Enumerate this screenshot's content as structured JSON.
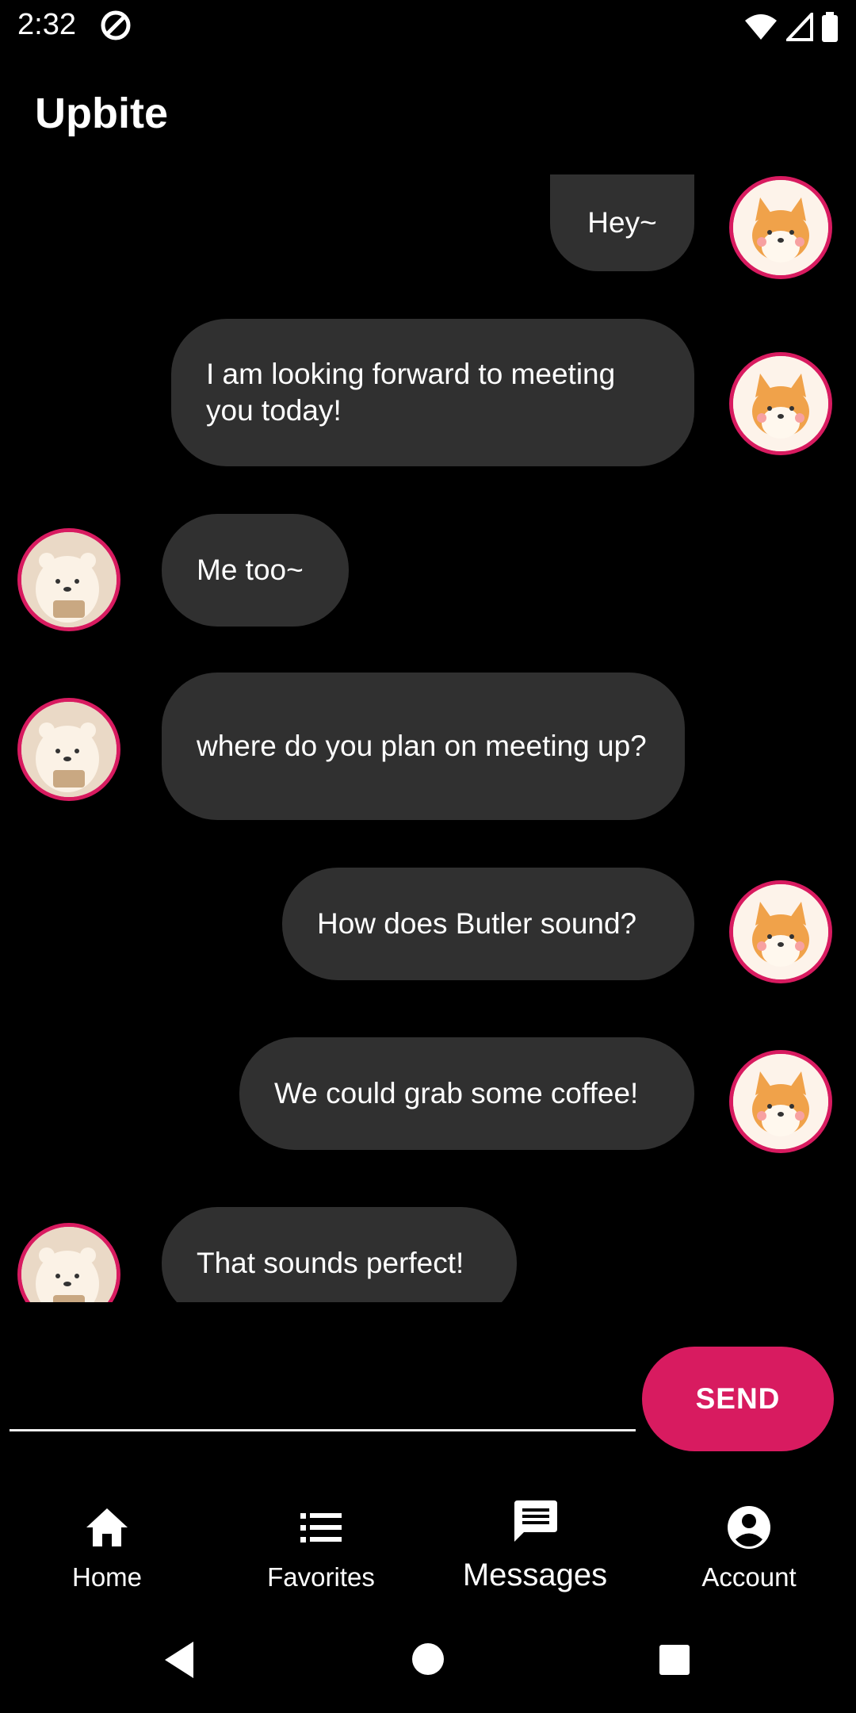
{
  "status_bar": {
    "time": "2:32"
  },
  "app": {
    "title": "Upbite"
  },
  "messages": [
    {
      "side": "right",
      "text": "Hey~",
      "avatar": "dog-avatar"
    },
    {
      "side": "right",
      "text": "I am looking forward to meeting you today!",
      "avatar": "dog-avatar"
    },
    {
      "side": "left",
      "text": "Me too~",
      "avatar": "bear-avatar"
    },
    {
      "side": "left",
      "text": "where do you plan on meeting up?",
      "avatar": "bear-avatar"
    },
    {
      "side": "right",
      "text": "How does Butler sound?",
      "avatar": "dog-avatar"
    },
    {
      "side": "right",
      "text": "We could grab some coffee!",
      "avatar": "dog-avatar"
    },
    {
      "side": "left",
      "text": "That sounds perfect!",
      "avatar": "bear-avatar"
    }
  ],
  "composer": {
    "value": "",
    "send_label": "SEND"
  },
  "nav": {
    "items": [
      {
        "label": "Home",
        "icon": "home-icon"
      },
      {
        "label": "Favorites",
        "icon": "list-icon"
      },
      {
        "label": "Messages",
        "icon": "message-icon",
        "active": true
      },
      {
        "label": "Account",
        "icon": "account-icon"
      }
    ]
  },
  "colors": {
    "accent": "#d81b60",
    "bubble": "#303030",
    "background": "#000000"
  }
}
